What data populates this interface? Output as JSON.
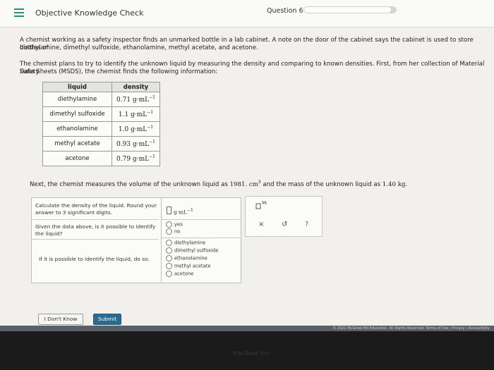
{
  "header": {
    "app_title": "Objective Knowledge Check",
    "question_label": "Question 6",
    "progress_fraction": 0.95
  },
  "prompt": {
    "para1_line1": "A chemist working as a safety inspector finds an unmarked bottle in a lab cabinet. A note on the door of the cabinet says the cabinet is used to store bottles of",
    "para1_line2": "diethylamine, dimethyl sulfoxide, ethanolamine, methyl acetate, and acetone.",
    "para2_line1": "The chemist plans to try to identify the unknown liquid by measuring the density and comparing to known densities. First, from her collection of Material Safety",
    "para2_line2": "Data Sheets (MSDS), the chemist finds the following information:",
    "measure_prefix": "Next, the chemist measures the volume of the unknown liquid as ",
    "volume_value": "1981.",
    "volume_unit": "cm",
    "measure_middle": " and the mass of the unknown liquid as ",
    "mass_value": "1.40",
    "mass_unit": "kg."
  },
  "table": {
    "header_liquid": "liquid",
    "header_density": "density",
    "rows": [
      {
        "liquid": "diethylamine",
        "density": "0.71",
        "unit": "g·mL"
      },
      {
        "liquid": "dimethyl sulfoxide",
        "density": "1.1",
        "unit": "g·mL"
      },
      {
        "liquid": "ethanolamine",
        "density": "1.0",
        "unit": "g·mL"
      },
      {
        "liquid": "methyl acetate",
        "density": "0.93",
        "unit": "g·mL"
      },
      {
        "liquid": "acetone",
        "density": "0.79",
        "unit": "g·mL"
      }
    ],
    "exponent": "−1"
  },
  "answer": {
    "q1_line1": "Calculate the density of the liquid. Round your",
    "q1_line2": "answer to 3 significant digits.",
    "q1_unit": "g·mL",
    "q1_exponent": "−1",
    "q2_line1": "Given the data above, is it possible to identify",
    "q2_line2": "the liquid?",
    "q2_options": [
      "yes",
      "no"
    ],
    "q3_line1": "If it is possible to identify the liquid, do so.",
    "q3_options": [
      "diethylamine",
      "dimethyl sulfoxide",
      "ethanolamine",
      "methyl acetate",
      "acetone"
    ]
  },
  "tools": {
    "clear": "×",
    "undo": "↺",
    "help": "?"
  },
  "buttons": {
    "dont_know": "I Don't Know",
    "submit": "Submit"
  },
  "footer": {
    "text": "© 2021 McGraw-Hill Education. All Rights Reserved.   Terms of Use  |  Privacy  |  Accessibility"
  },
  "bezel": {
    "label": "MacBook Pro"
  },
  "colors": {
    "accent": "#2a8f6a",
    "submit": "#2d6a8f"
  }
}
